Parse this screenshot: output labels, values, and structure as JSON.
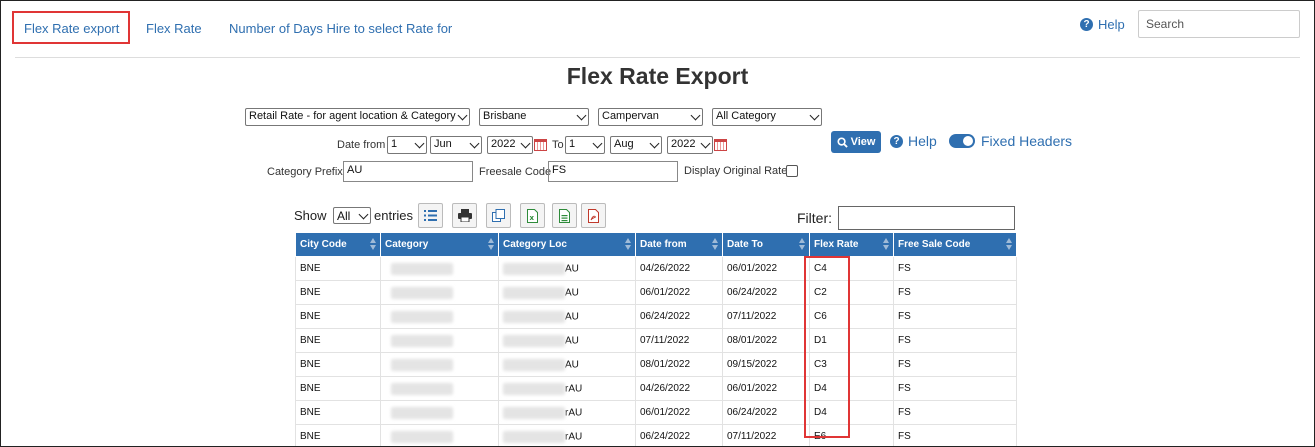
{
  "nav": {
    "items": [
      "Flex Rate export",
      "Flex Rate",
      "Number of Days Hire to select Rate for"
    ],
    "help": "Help",
    "search_placeholder": "Search"
  },
  "page_title": "Flex Rate Export",
  "filters": {
    "rate_type": "Retail Rate - for agent location & Category",
    "city": "Brisbane",
    "vehicle": "Campervan",
    "category": "All Category",
    "date_from_label": "Date from",
    "date_from": {
      "day": "1",
      "month": "Jun",
      "year": "2022"
    },
    "to_label": "To",
    "date_to": {
      "day": "1",
      "month": "Aug",
      "year": "2022"
    },
    "category_prefix_label": "Category Prefix",
    "category_prefix": "AU",
    "freesale_code_label": "Freesale Code",
    "freesale_code": "FS",
    "display_original_rate_label": "Display Original Rate",
    "display_original_rate": false
  },
  "actions": {
    "view": "View",
    "help": "Help",
    "fixed_headers": "Fixed Headers"
  },
  "table_controls": {
    "show_label": "Show",
    "show_value": "All",
    "entries_label": "entries",
    "filter_label": "Filter:"
  },
  "table": {
    "columns": [
      "City Code",
      "Category",
      "Category Loc",
      "Date from",
      "Date To",
      "Flex Rate",
      "Free Sale Code"
    ],
    "rows": [
      {
        "city": "BNE",
        "loc_suffix": "AU",
        "date_from": "04/26/2022",
        "date_to": "06/01/2022",
        "flex_rate": "C4",
        "free_sale": "FS"
      },
      {
        "city": "BNE",
        "loc_suffix": "AU",
        "date_from": "06/01/2022",
        "date_to": "06/24/2022",
        "flex_rate": "C2",
        "free_sale": "FS"
      },
      {
        "city": "BNE",
        "loc_suffix": "AU",
        "date_from": "06/24/2022",
        "date_to": "07/11/2022",
        "flex_rate": "C6",
        "free_sale": "FS"
      },
      {
        "city": "BNE",
        "loc_suffix": "AU",
        "date_from": "07/11/2022",
        "date_to": "08/01/2022",
        "flex_rate": "D1",
        "free_sale": "FS"
      },
      {
        "city": "BNE",
        "loc_suffix": "AU",
        "date_from": "08/01/2022",
        "date_to": "09/15/2022",
        "flex_rate": "C3",
        "free_sale": "FS"
      },
      {
        "city": "BNE",
        "loc_suffix": "rAU",
        "date_from": "04/26/2022",
        "date_to": "06/01/2022",
        "flex_rate": "D4",
        "free_sale": "FS"
      },
      {
        "city": "BNE",
        "loc_suffix": "rAU",
        "date_from": "06/01/2022",
        "date_to": "06/24/2022",
        "flex_rate": "D4",
        "free_sale": "FS"
      },
      {
        "city": "BNE",
        "loc_suffix": "rAU",
        "date_from": "06/24/2022",
        "date_to": "07/11/2022",
        "flex_rate": "E6",
        "free_sale": "FS"
      }
    ]
  },
  "colors": {
    "accent": "#2f6fb0",
    "highlight": "#e03535"
  }
}
